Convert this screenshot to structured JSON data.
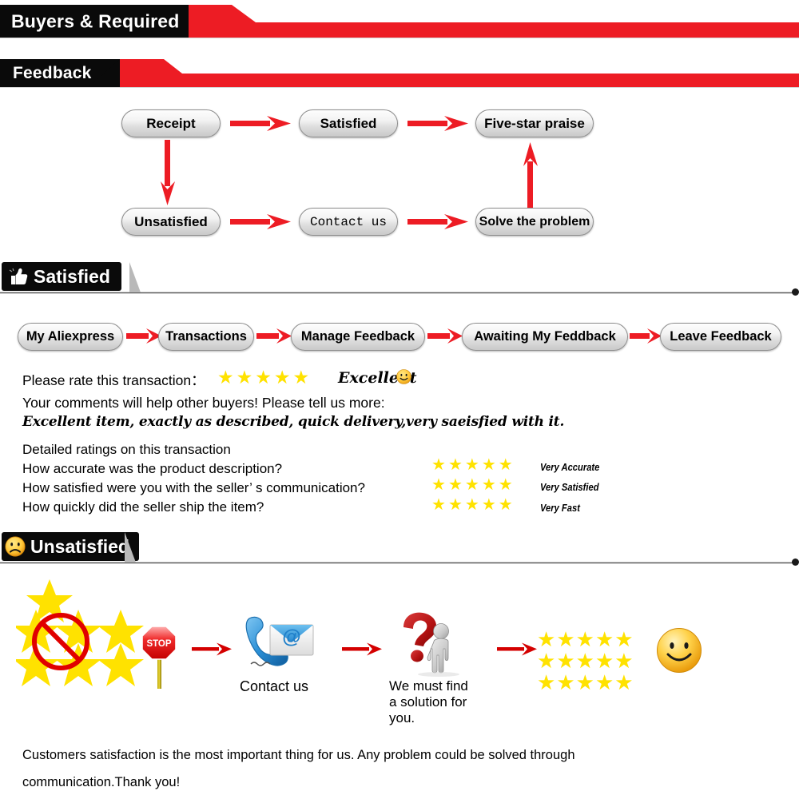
{
  "banners": [
    {
      "id": "buyers",
      "title": "Buyers & Required"
    },
    {
      "id": "feedback",
      "title": "Feedback"
    }
  ],
  "flowchart": {
    "nodes": [
      {
        "label": "Receipt",
        "font": "sans"
      },
      {
        "label": "Satisfied",
        "font": "sans"
      },
      {
        "label": "Five-star praise",
        "font": "sans"
      },
      {
        "label": "Unsatisfied",
        "font": "sans"
      },
      {
        "label": "Contact us",
        "font": "mono"
      },
      {
        "label": "Solve the problem",
        "font": "sans"
      }
    ]
  },
  "satisfied_section": {
    "header": "Satisfied",
    "header_icon": "thumbs-up-icon",
    "steps": [
      "My Aliexpress",
      "Transactions",
      "Manage Feedback",
      "Awaiting My Feddback",
      "Leave Feedback"
    ],
    "rate_prompt": "Please rate this transaction：",
    "rate_stars": 5,
    "rate_word": "Excellent",
    "rate_emoji": "smiley-icon",
    "comments_prompt": "Your comments will help other buyers! Please tell us more:",
    "comment_text": "Excellent item, exactly as described, quick delivery,very saeisfied with it.",
    "detailed_heading": "Detailed ratings on this transaction",
    "detailed_rows": [
      {
        "question": "How accurate was the product description?",
        "stars": 5,
        "value": "Very Accurate"
      },
      {
        "question": "How satisfied were you with the seller’ s communication?",
        "stars": 5,
        "value": "Very Satisfied"
      },
      {
        "question": "How quickly did the seller ship the item?",
        "stars": 5,
        "value": "Very Fast"
      }
    ]
  },
  "unsatisfied_section": {
    "header": "Unsatisfied",
    "header_icon": "sad-face-icon",
    "icons": {
      "no_stars": "no-stars-icon",
      "stop_sign": "stop-sign-icon",
      "stop_text": "STOP",
      "contact": "phone-email-icon",
      "question": "question-mark-person-icon",
      "five_star_grid": "star-grid-icon",
      "happy": "happy-face-icon"
    },
    "caption_contact": "Contact us",
    "caption_solution": "We must find\na solution for\nyou.",
    "star_grid_rows": 3,
    "star_grid_cols": 5,
    "closing_line1": "Customers satisfaction is the most important thing for us. Any problem could be solved through",
    "closing_line2": "communication.Thank you!"
  },
  "colors": {
    "red": "#ED1C24",
    "black": "#000000",
    "star_yellow": "#FFE200",
    "pill_border": "#8e8e8e"
  }
}
